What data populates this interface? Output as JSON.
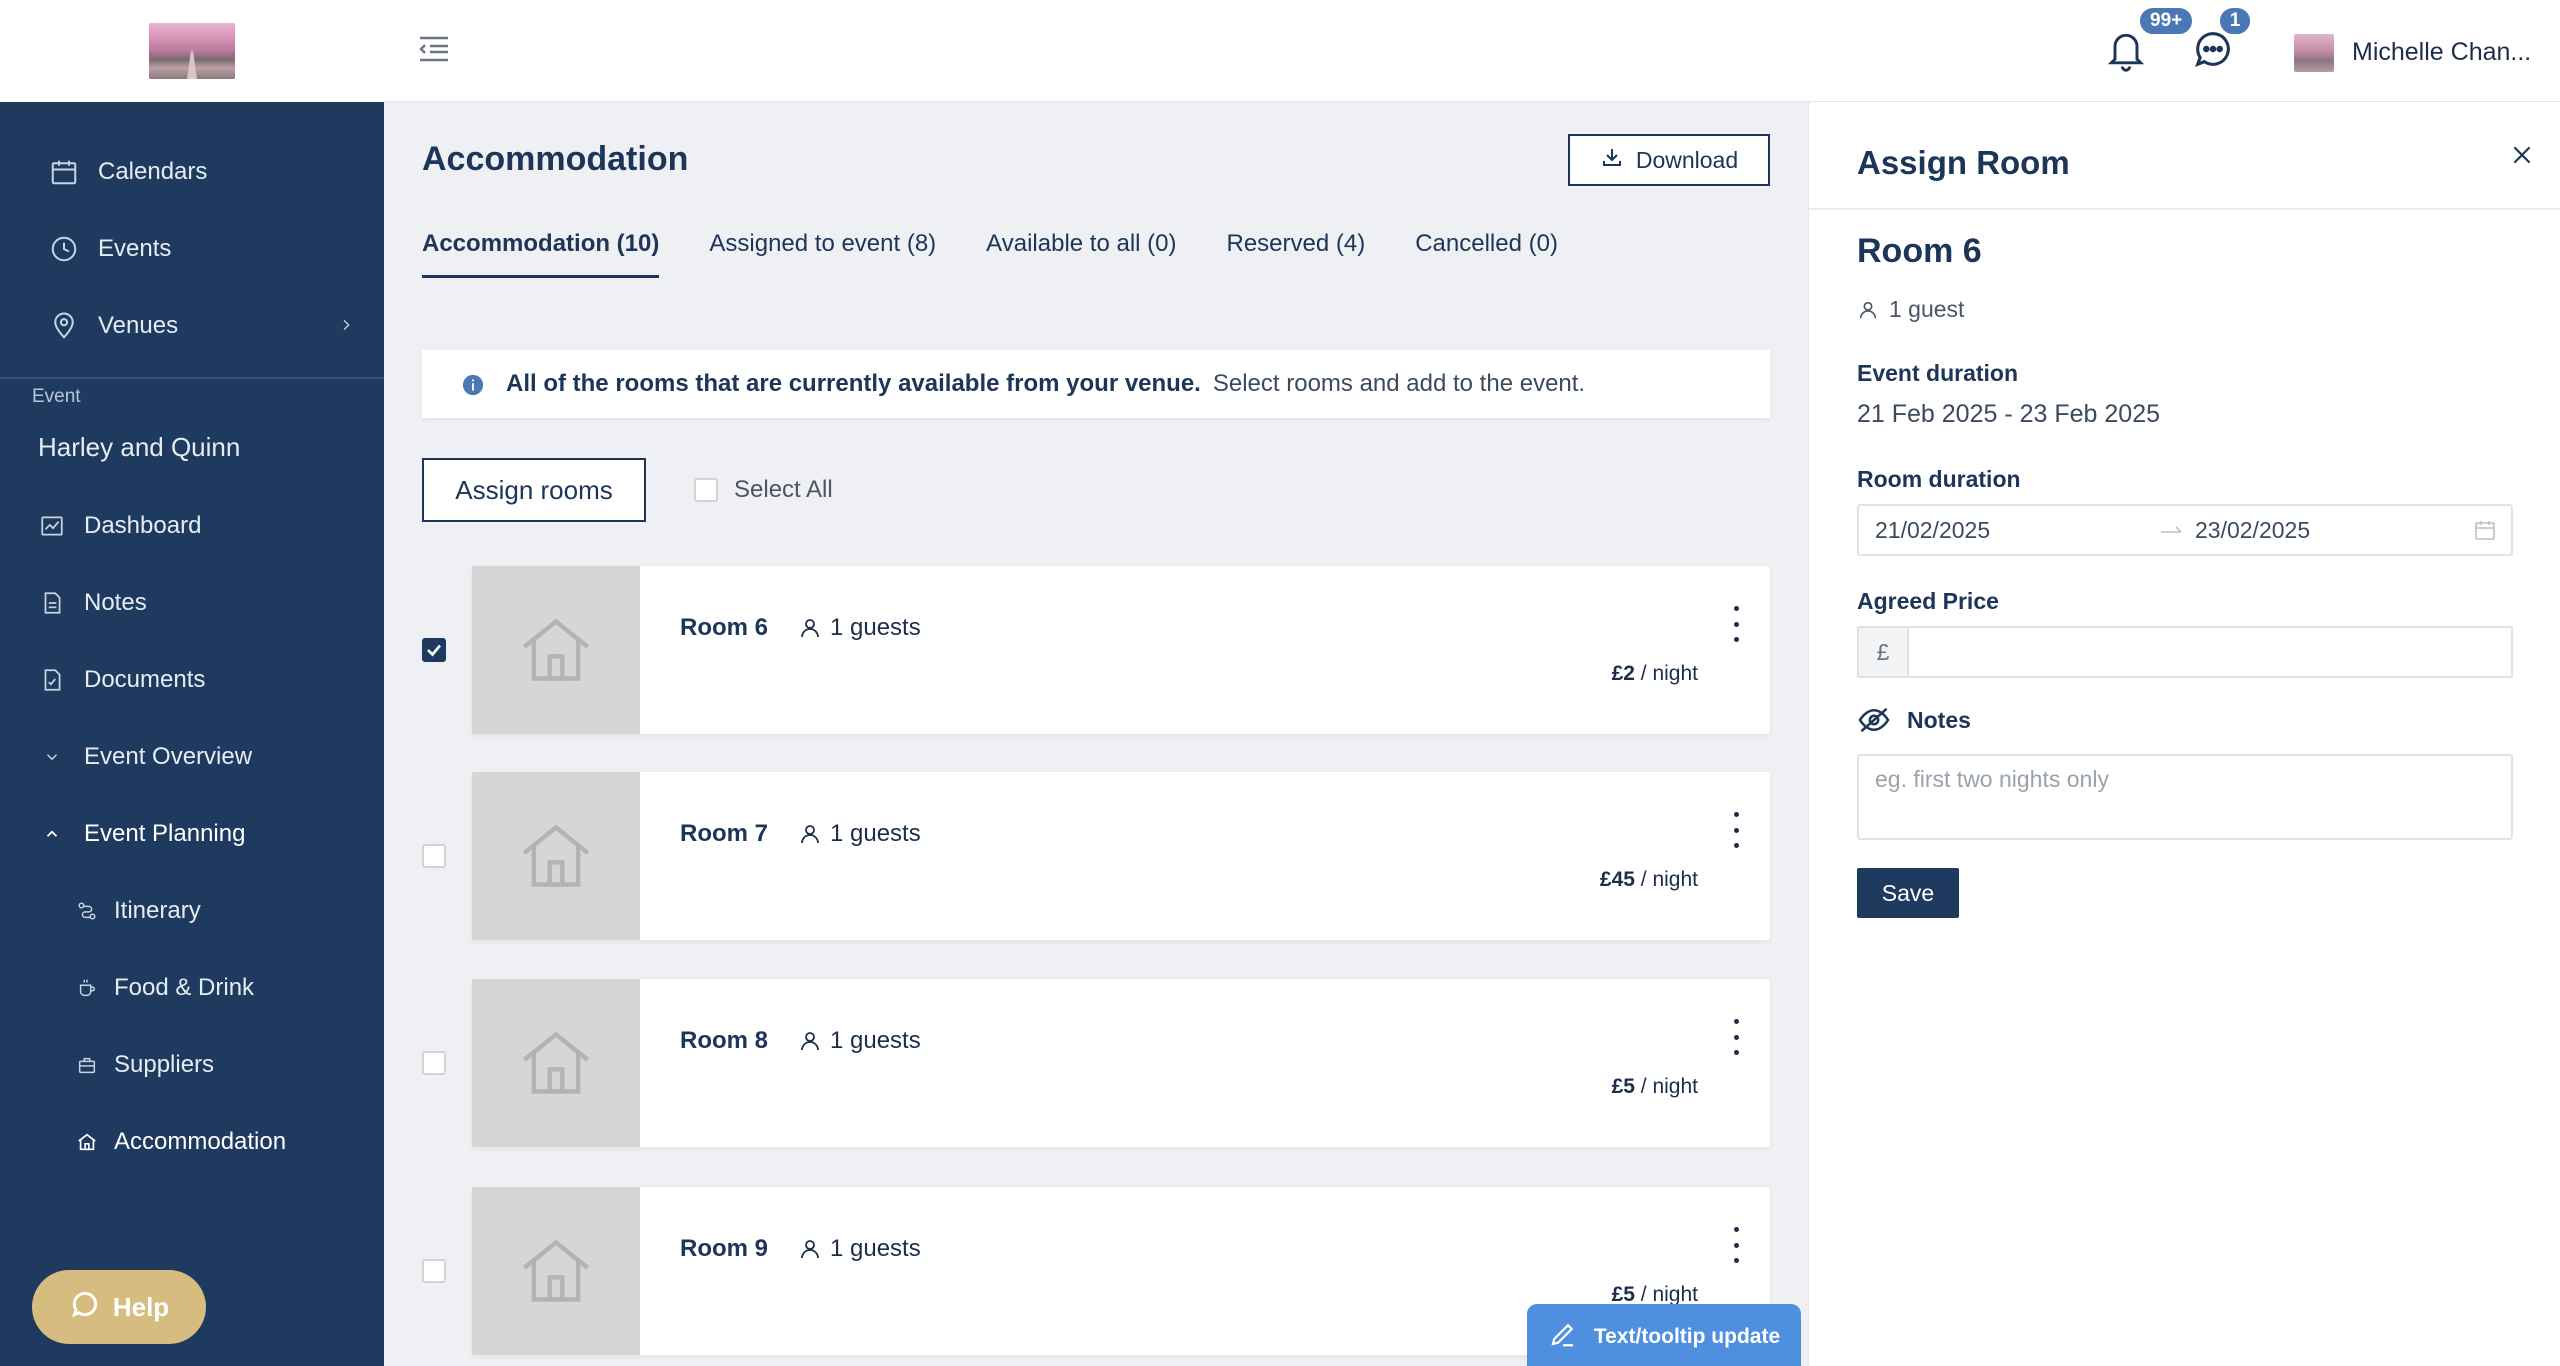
{
  "sidebar": {
    "nav": [
      {
        "label": "Calendars",
        "icon": "calendar-icon"
      },
      {
        "label": "Events",
        "icon": "clock-icon"
      },
      {
        "label": "Venues",
        "icon": "location-pin-icon"
      }
    ],
    "event_caption": "Event",
    "event_name": "Harley and Quinn",
    "event_nav": [
      {
        "label": "Dashboard"
      },
      {
        "label": "Notes"
      },
      {
        "label": "Documents"
      },
      {
        "label": "Event Overview"
      },
      {
        "label": "Event Planning"
      }
    ],
    "planning_sub": [
      {
        "label": "Itinerary"
      },
      {
        "label": "Food & Drink"
      },
      {
        "label": "Suppliers"
      },
      {
        "label": "Accommodation"
      }
    ],
    "help_label": "Help"
  },
  "header": {
    "notifications_badge": "99+",
    "messages_badge": "1",
    "user_name": "Michelle Chan..."
  },
  "main": {
    "title": "Accommodation",
    "download_label": "Download",
    "tabs": [
      {
        "label": "Accommodation (10)"
      },
      {
        "label": "Assigned to event (8)"
      },
      {
        "label": "Available to all (0)"
      },
      {
        "label": "Reserved (4)"
      },
      {
        "label": "Cancelled (0)"
      }
    ],
    "info_strong": "All of the rooms that are currently available from your venue.",
    "info_text": "Select rooms and add to the event.",
    "assign_rooms_label": "Assign rooms",
    "select_all_label": "Select All",
    "rooms": [
      {
        "name": "Room 6",
        "guests": "1 guests",
        "price": "£2",
        "per": "/ night",
        "checked": true
      },
      {
        "name": "Room 7",
        "guests": "1 guests",
        "price": "£45",
        "per": "/ night",
        "checked": false
      },
      {
        "name": "Room 8",
        "guests": "1 guests",
        "price": "£5",
        "per": "/ night",
        "checked": false
      },
      {
        "name": "Room 9",
        "guests": "1 guests",
        "price": "£5",
        "per": "/ night",
        "checked": false
      }
    ],
    "tooltip_update_label": "Text/tooltip update"
  },
  "panel": {
    "title": "Assign Room",
    "room_name": "Room 6",
    "guest_text": "1 guest",
    "event_duration_label": "Event duration",
    "event_duration_value": "21 Feb 2025 - 23 Feb 2025",
    "room_duration_label": "Room duration",
    "room_start": "21/02/2025",
    "room_end": "23/02/2025",
    "agreed_price_label": "Agreed Price",
    "currency_symbol": "£",
    "notes_label": "Notes",
    "notes_placeholder": "eg. first two nights only",
    "save_label": "Save"
  },
  "colors": {
    "sidebar_bg": "#1f3a5f",
    "accent": "#1c3558",
    "help": "#d6bd7f",
    "badge": "#4b77b4",
    "tooltip_button": "#4f8fe0"
  }
}
